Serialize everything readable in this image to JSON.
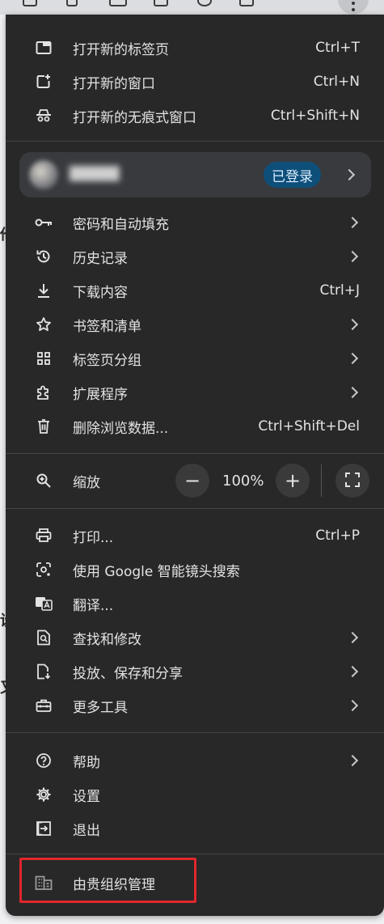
{
  "menu": {
    "section1": [
      {
        "label": "打开新的标签页",
        "shortcut": "Ctrl+T",
        "icon": "new-tab-icon"
      },
      {
        "label": "打开新的窗口",
        "shortcut": "Ctrl+N",
        "icon": "new-window-icon"
      },
      {
        "label": "打开新的无痕式窗口",
        "shortcut": "Ctrl+Shift+N",
        "icon": "incognito-icon"
      }
    ],
    "profile": {
      "status": "已登录"
    },
    "section2": [
      {
        "label": "密码和自动填充",
        "icon": "key-icon"
      },
      {
        "label": "历史记录",
        "icon": "history-icon"
      },
      {
        "label": "下载内容",
        "shortcut": "Ctrl+J",
        "icon": "download-icon"
      },
      {
        "label": "书签和清单",
        "icon": "star-icon"
      },
      {
        "label": "标签页分组",
        "icon": "grid-icon"
      },
      {
        "label": "扩展程序",
        "icon": "puzzle-icon"
      },
      {
        "label": "删除浏览数据...",
        "shortcut": "Ctrl+Shift+Del",
        "icon": "trash-icon"
      }
    ],
    "zoom": {
      "label": "缩放",
      "value": "100%",
      "minus": "−",
      "plus": "+"
    },
    "section3": [
      {
        "label": "打印...",
        "shortcut": "Ctrl+P",
        "icon": "print-icon"
      },
      {
        "label": "使用 Google 智能镜头搜索",
        "icon": "lens-icon"
      },
      {
        "label": "翻译...",
        "icon": "translate-icon"
      },
      {
        "label": "查找和修改",
        "icon": "find-icon"
      },
      {
        "label": "投放、保存和分享",
        "icon": "cast-save-icon"
      },
      {
        "label": "更多工具",
        "icon": "toolbox-icon"
      }
    ],
    "section4": [
      {
        "label": "帮助",
        "icon": "help-icon"
      },
      {
        "label": "设置",
        "icon": "gear-icon"
      },
      {
        "label": "退出",
        "icon": "exit-icon"
      }
    ],
    "managed": {
      "label": "由贵组织管理",
      "icon": "building-icon"
    }
  },
  "colors": {
    "menu_bg": "#282828",
    "highlight": "#e3262d",
    "badge": "#0e4f7a"
  }
}
